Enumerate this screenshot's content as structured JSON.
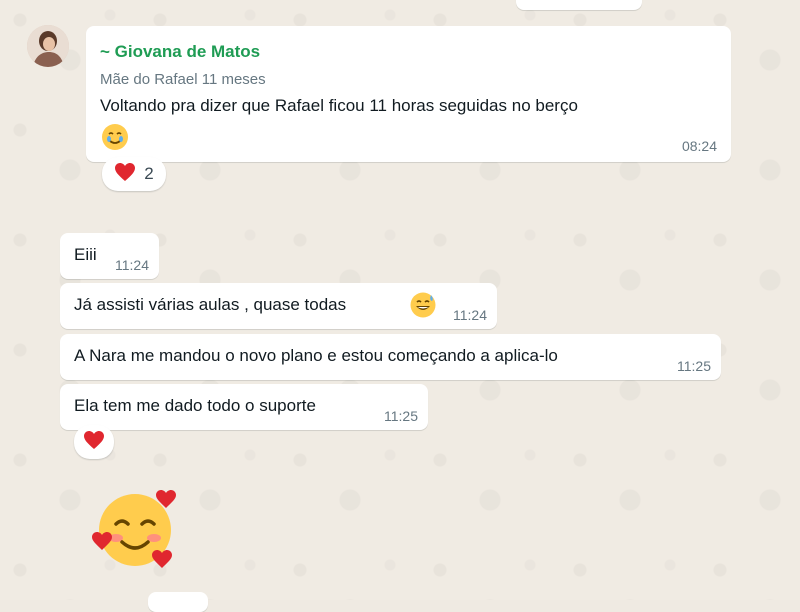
{
  "colors": {
    "wallpaper": "#efeae2",
    "bubble": "#ffffff",
    "sender_name": "#1f9c54",
    "meta_text": "#667781",
    "text": "#111b21"
  },
  "messages": [
    {
      "sender": "~ Giovana de Matos",
      "sender_info": "Mãe do Rafael 11 meses",
      "text_line1": "Voltando pra dizer que Rafael ficou 11 horas seguidas no berço",
      "emoji": "smiling-face-with-tear",
      "time": "08:24",
      "reaction": {
        "emoji": "red-heart",
        "count": "2"
      }
    },
    {
      "text": "Eiii",
      "time": "11:24"
    },
    {
      "text": "Já assisti várias aulas , quase todas",
      "emoji": "grinning-face-with-sweat",
      "time": "11:24"
    },
    {
      "text": "A Nara me mandou o novo plano e estou começando a aplica-lo",
      "time": "11:25"
    },
    {
      "text": "Ela tem me dado todo o suporte",
      "time": "11:25",
      "reaction": {
        "emoji": "red-heart"
      }
    },
    {
      "sticker": "smiling-face-with-hearts"
    }
  ]
}
